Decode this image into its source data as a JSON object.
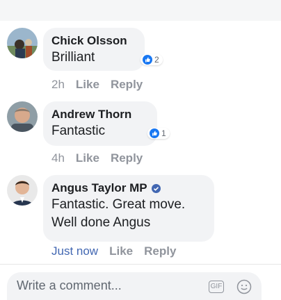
{
  "comments": [
    {
      "author": "Chick Olsson",
      "text": "Brilliant",
      "reaction_count": "2",
      "time": "2h",
      "like_label": "Like",
      "reply_label": "Reply",
      "avatar_icon": "profile-photo-chick"
    },
    {
      "author": "Andrew Thorn",
      "text": "Fantastic",
      "reaction_count": "1",
      "time": "4h",
      "like_label": "Like",
      "reply_label": "Reply",
      "avatar_icon": "profile-photo-andrew"
    },
    {
      "author": "Angus Taylor MP",
      "text_line1": "Fantastic. Great move.",
      "text_line2": "Well done Angus",
      "time": "Just now",
      "like_label": "Like",
      "reply_label": "Reply",
      "verified": true,
      "avatar_icon": "profile-photo-angus"
    }
  ],
  "composer": {
    "placeholder": "Write a comment...",
    "gif_label": "GIF",
    "emoji_icon": "smiley-icon"
  },
  "colors": {
    "link_blue": "#4267b2",
    "reaction_blue": "#1877f2",
    "meta_gray": "#90949c",
    "bubble_bg": "#f2f3f5"
  }
}
